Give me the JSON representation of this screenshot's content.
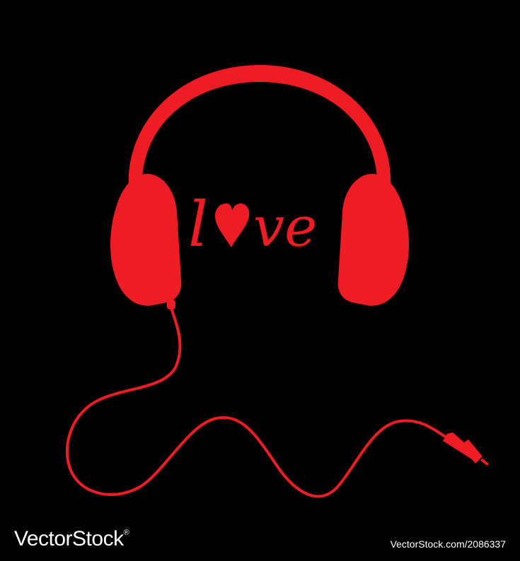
{
  "illustration": {
    "word_prefix": "l",
    "word_suffix": "ve",
    "colors": {
      "background": "#000000",
      "accent": "#ee1c25",
      "footer_text": "#ffffff"
    },
    "icons": [
      "headphones-icon",
      "heart-icon",
      "audio-jack-icon"
    ]
  },
  "footer": {
    "logo": "VectorStock",
    "logo_mark": "®",
    "credit": "VectorStock.com/2086337"
  }
}
